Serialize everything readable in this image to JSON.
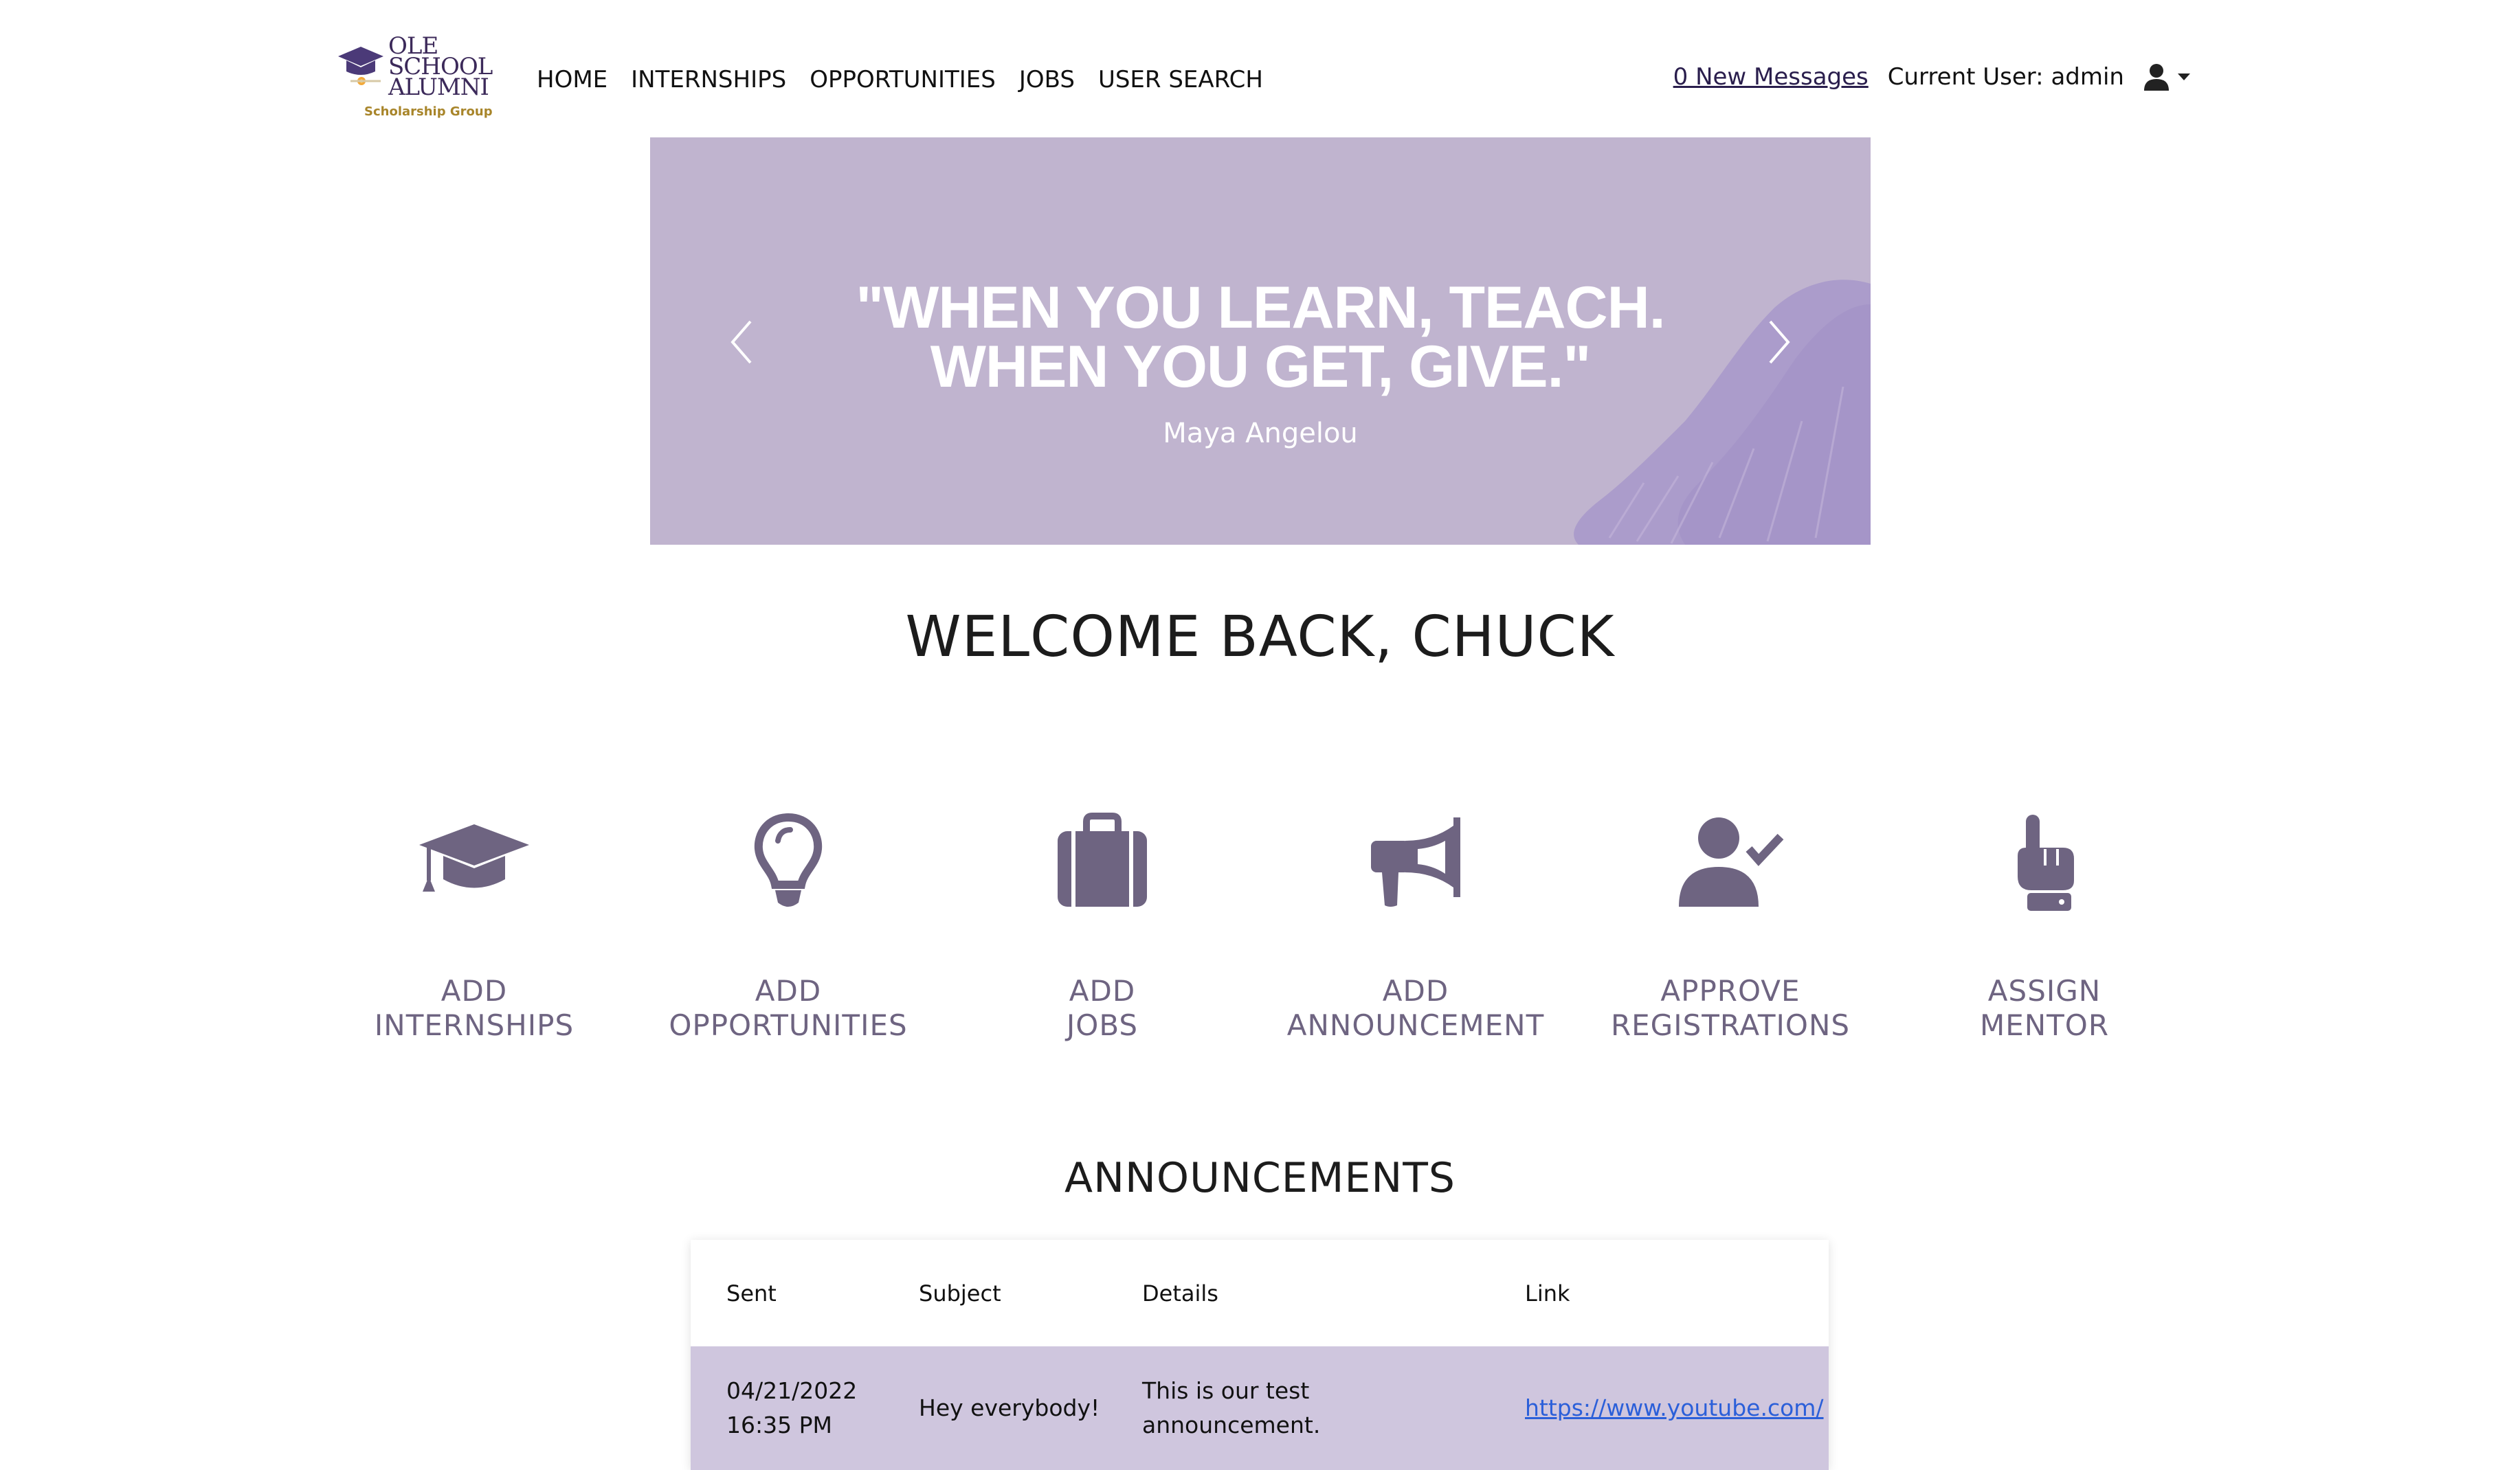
{
  "brand": {
    "logo_lines": [
      "OLE",
      "SCHOOL",
      "ALUMNI"
    ],
    "logo_subtitle": "Scholarship Group",
    "colors": {
      "primary": "#3c2a5a",
      "gold": "#a8852a"
    }
  },
  "nav": {
    "items": [
      {
        "label": "HOME"
      },
      {
        "label": "INTERNSHIPS"
      },
      {
        "label": "OPPORTUNITIES"
      },
      {
        "label": "JOBS"
      },
      {
        "label": "USER SEARCH"
      }
    ],
    "messages_link": "0 New Messages",
    "current_user_label": "Current User:",
    "current_user_name": "admin",
    "user_icon": "user-icon"
  },
  "carousel": {
    "quote_line1": "\"WHEN YOU LEARN, TEACH.",
    "quote_line2": "WHEN YOU GET, GIVE.\"",
    "author": "Maya Angelou",
    "background": "#c0b4cf"
  },
  "welcome": {
    "title": "WELCOME BACK, CHUCK"
  },
  "actions": [
    {
      "label": "ADD\nINTERNSHIPS",
      "icon": "graduation-cap-icon"
    },
    {
      "label": "ADD\nOPPORTUNITIES",
      "icon": "lightbulb-icon"
    },
    {
      "label": "ADD\nJOBS",
      "icon": "briefcase-icon"
    },
    {
      "label": "ADD\nANNOUNCEMENT",
      "icon": "megaphone-icon"
    },
    {
      "label": "APPROVE\nREGISTRATIONS",
      "icon": "user-check-icon"
    },
    {
      "label": "ASSIGN\nMENTOR",
      "icon": "pointing-hand-icon"
    }
  ],
  "announcements": {
    "title": "ANNOUNCEMENTS",
    "columns": [
      "Sent",
      "Subject",
      "Details",
      "Link"
    ],
    "rows": [
      {
        "sent_date": "04/21/2022",
        "sent_time": "16:35 PM",
        "subject": "Hey everybody!",
        "details": "This is our test announcement.",
        "link": "https://www.youtube.com/"
      }
    ],
    "row_color": "#cfc6de"
  }
}
